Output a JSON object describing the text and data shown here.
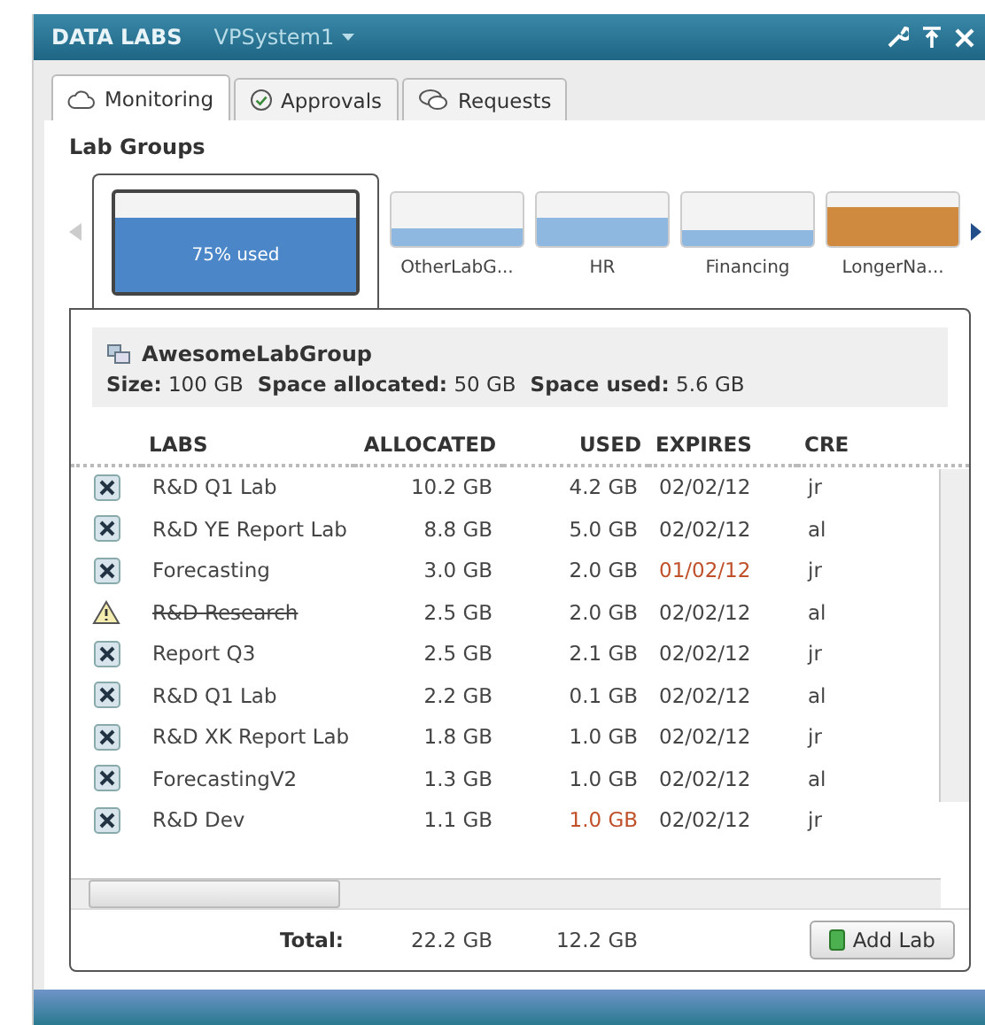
{
  "window": {
    "title": "DATA LABS",
    "system": "VPSystem1"
  },
  "tabs": [
    {
      "label": "Monitoring",
      "selected": true
    },
    {
      "label": "Approvals",
      "selected": false
    },
    {
      "label": "Requests",
      "selected": false
    }
  ],
  "lab_groups": {
    "heading": "Lab Groups",
    "items": [
      {
        "usage_label": "75% used",
        "color": "#4a86c8",
        "selected": true
      },
      {
        "name": "OtherLabG...",
        "color": "#8fb8e0",
        "selected": false
      },
      {
        "name": "HR",
        "color": "#8fb8e0",
        "selected": false
      },
      {
        "name": "Financing",
        "color": "#8fb8e0",
        "selected": false
      },
      {
        "name": "LongerNa...",
        "color": "#d08a40",
        "selected": false
      }
    ]
  },
  "group_detail": {
    "name": "AwesomeLabGroup",
    "stats": [
      {
        "label": "Size:",
        "value": "100 GB"
      },
      {
        "label": "Space allocated:",
        "value": "50 GB"
      },
      {
        "label": "Space used:",
        "value": "5.6 GB"
      }
    ]
  },
  "table": {
    "columns": [
      "LABS",
      "ALLOCATED",
      "USED",
      "EXPIRES",
      "CRE"
    ],
    "rows": [
      {
        "kind": "delete",
        "lab": "R&D Q1 Lab",
        "allocated": "10.2 GB",
        "used": "4.2 GB",
        "expires": "02/02/12",
        "creator": "jr",
        "struck": false,
        "expires_alert": false,
        "used_alert": false
      },
      {
        "kind": "delete",
        "lab": "R&D YE Report Lab",
        "allocated": "8.8 GB",
        "used": "5.0 GB",
        "expires": "02/02/12",
        "creator": "al",
        "struck": false,
        "expires_alert": false,
        "used_alert": false
      },
      {
        "kind": "delete",
        "lab": "Forecasting",
        "allocated": "3.0 GB",
        "used": "2.0 GB",
        "expires": "01/02/12",
        "creator": "jr",
        "struck": false,
        "expires_alert": true,
        "used_alert": false
      },
      {
        "kind": "warning",
        "lab": "R&D Research",
        "allocated": "2.5 GB",
        "used": "2.0 GB",
        "expires": "02/02/12",
        "creator": "al",
        "struck": true,
        "expires_alert": false,
        "used_alert": false
      },
      {
        "kind": "delete",
        "lab": "Report Q3",
        "allocated": "2.5 GB",
        "used": "2.1 GB",
        "expires": "02/02/12",
        "creator": "jr",
        "struck": false,
        "expires_alert": false,
        "used_alert": false
      },
      {
        "kind": "delete",
        "lab": "R&D Q1 Lab",
        "allocated": "2.2 GB",
        "used": "0.1 GB",
        "expires": "02/02/12",
        "creator": "al",
        "struck": false,
        "expires_alert": false,
        "used_alert": false
      },
      {
        "kind": "delete",
        "lab": "R&D XK Report Lab",
        "allocated": "1.8 GB",
        "used": "1.0 GB",
        "expires": "02/02/12",
        "creator": "jr",
        "struck": false,
        "expires_alert": false,
        "used_alert": false
      },
      {
        "kind": "delete",
        "lab": "ForecastingV2",
        "allocated": "1.3 GB",
        "used": "1.0 GB",
        "expires": "02/02/12",
        "creator": "al",
        "struck": false,
        "expires_alert": false,
        "used_alert": false
      },
      {
        "kind": "delete",
        "lab": "R&D Dev",
        "allocated": "1.1 GB",
        "used": "1.0 GB",
        "expires": "02/02/12",
        "creator": "jr",
        "struck": false,
        "expires_alert": false,
        "used_alert": true
      }
    ],
    "total_label": "Total:",
    "total_allocated": "22.2 GB",
    "total_used": "12.2 GB"
  },
  "add_button": "Add Lab"
}
